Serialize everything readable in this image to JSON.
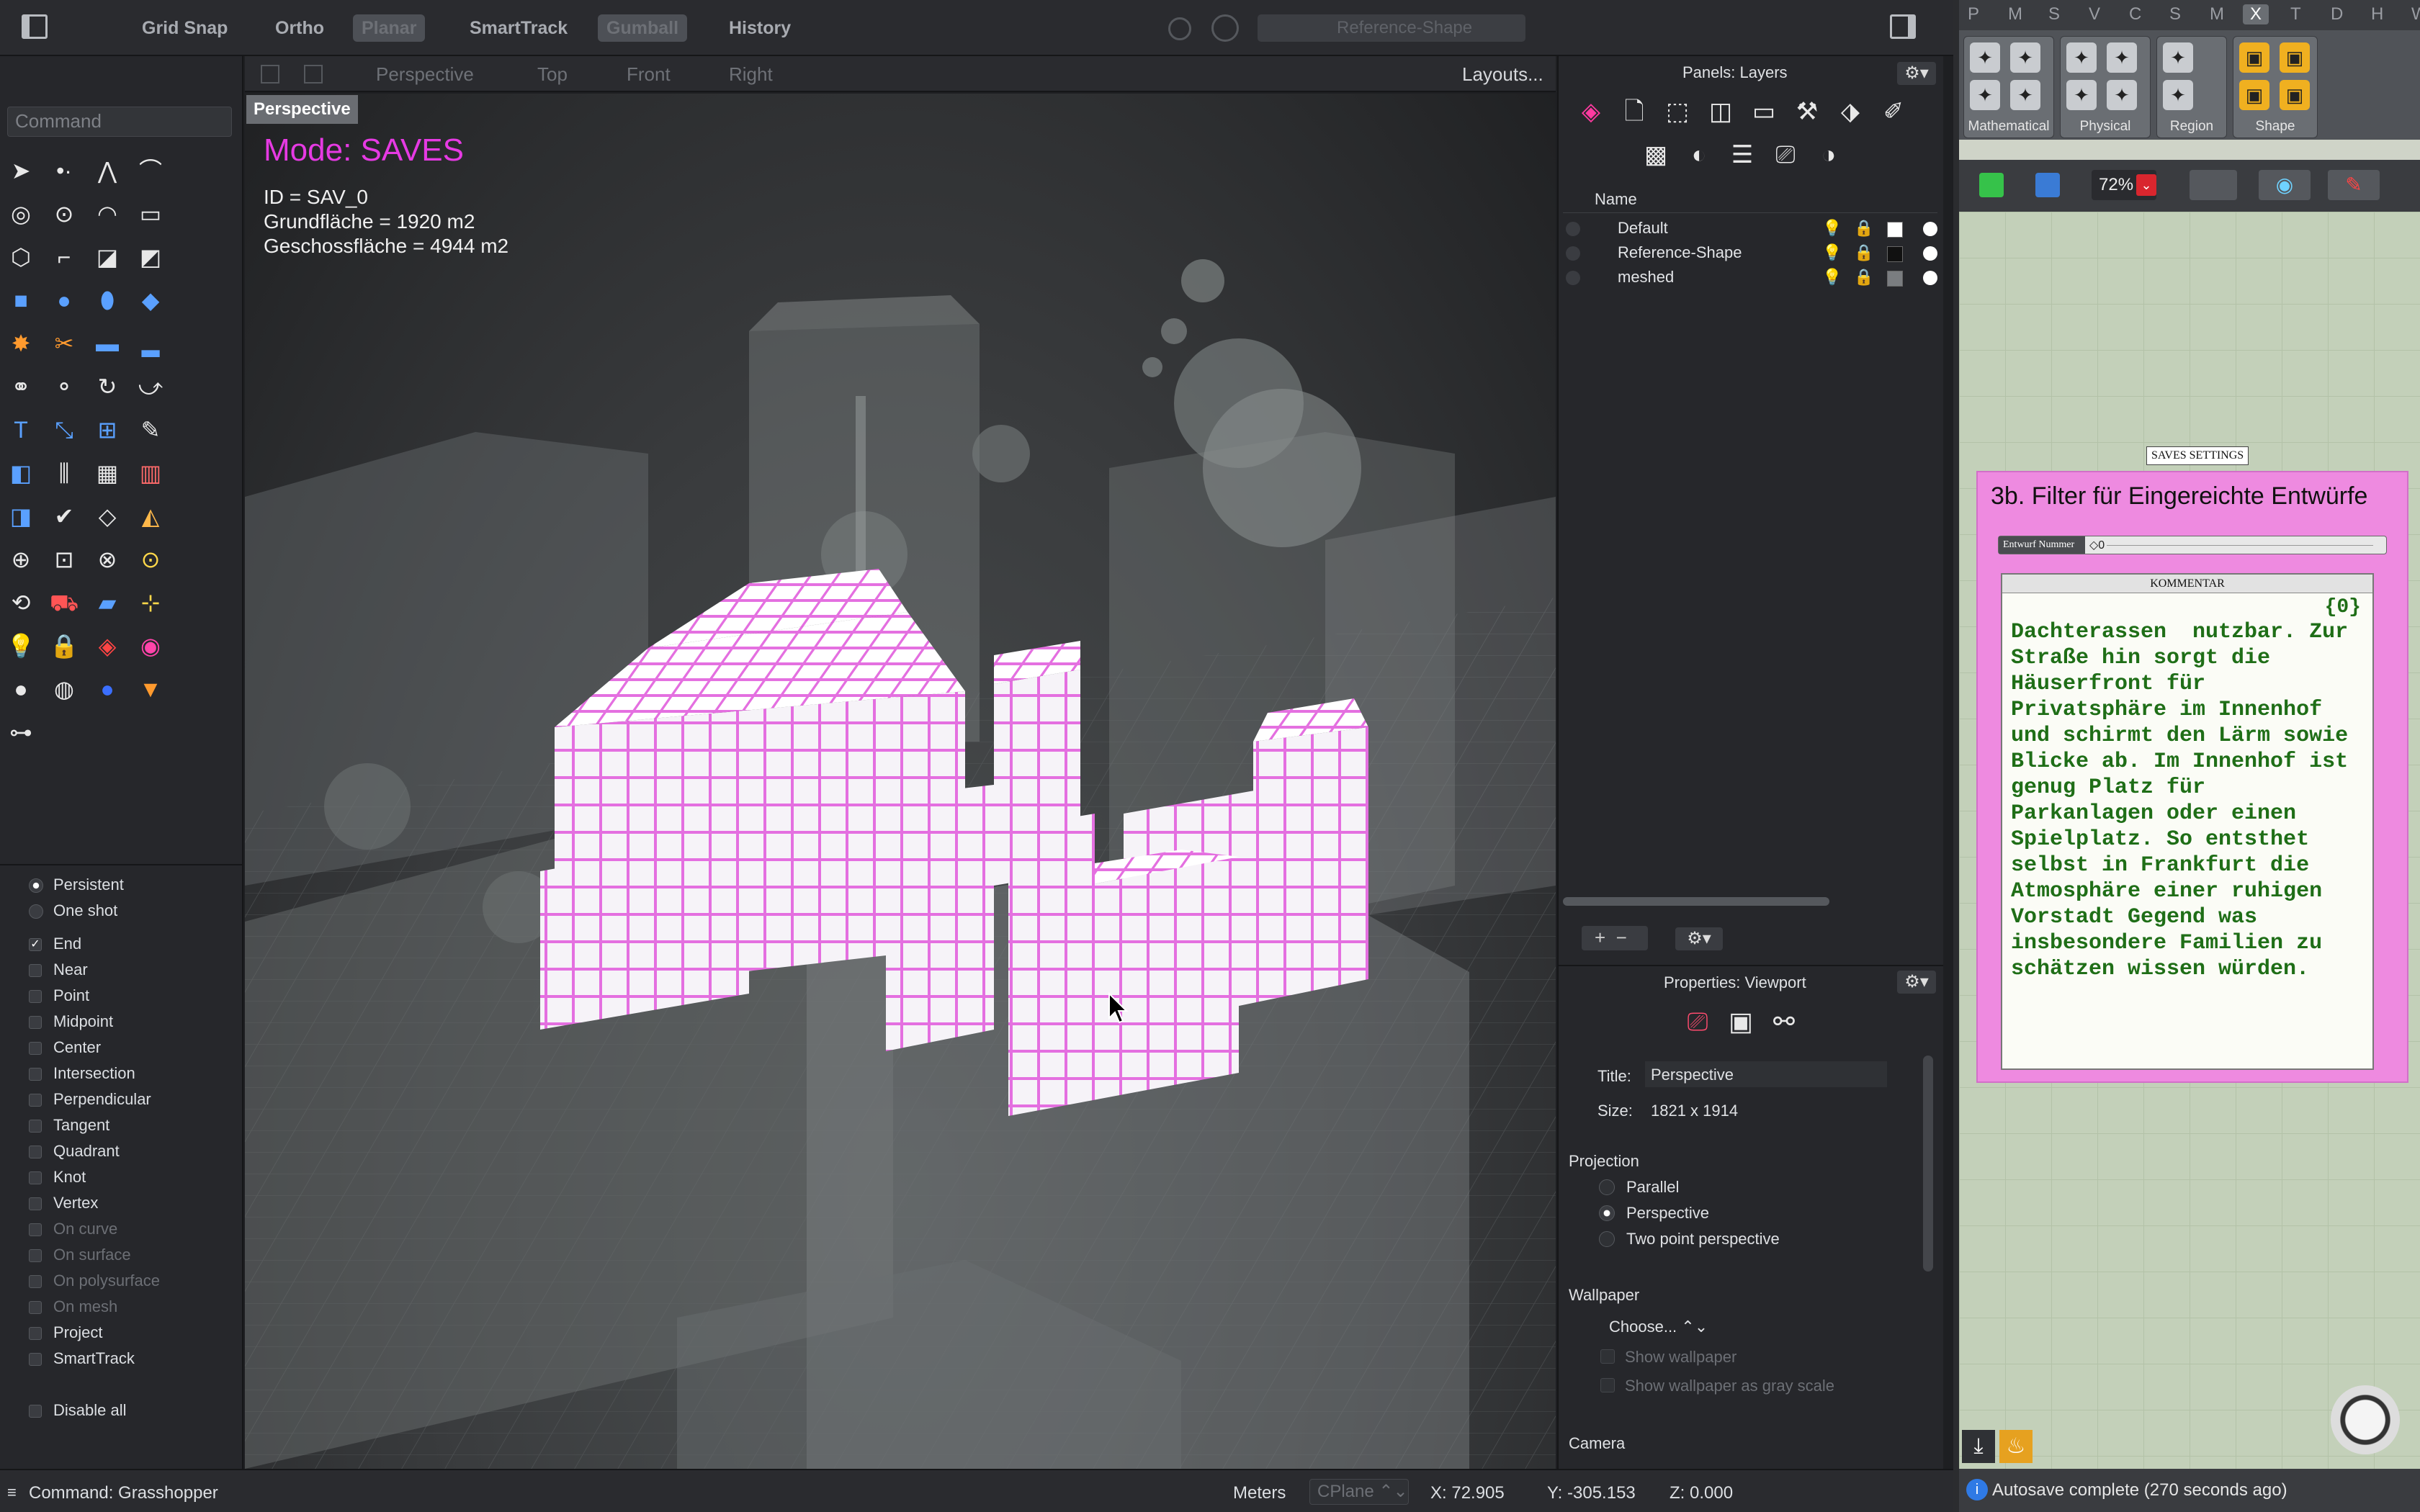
{
  "toolbar": {
    "grid_snap": "Grid Snap",
    "ortho": "Ortho",
    "planar": "Planar",
    "smarttrack": "SmartTrack",
    "gumball": "Gumball",
    "history": "History",
    "layer_field": "Reference-Shape"
  },
  "command": {
    "placeholder": "Command"
  },
  "viewport_tabs": {
    "perspective": "Perspective",
    "top": "Top",
    "front": "Front",
    "right": "Right",
    "layouts": "Layouts..."
  },
  "viewport": {
    "label": "Perspective",
    "mode": "Mode: SAVES",
    "id_line": "ID = SAV_0",
    "grundflaeche": "Grundfläche = 1920 m2",
    "geschossflaeche": "Geschossfläche = 4944 m2"
  },
  "osnaps": [
    {
      "label": "Persistent",
      "type": "radio",
      "on": true,
      "dim": false
    },
    {
      "label": "One shot",
      "type": "radio",
      "on": false,
      "dim": false
    },
    {
      "label": "End",
      "type": "check",
      "on": true,
      "dim": false
    },
    {
      "label": "Near",
      "type": "check",
      "on": false,
      "dim": false
    },
    {
      "label": "Point",
      "type": "check",
      "on": false,
      "dim": false
    },
    {
      "label": "Midpoint",
      "type": "check",
      "on": false,
      "dim": false
    },
    {
      "label": "Center",
      "type": "check",
      "on": false,
      "dim": false
    },
    {
      "label": "Intersection",
      "type": "check",
      "on": false,
      "dim": false
    },
    {
      "label": "Perpendicular",
      "type": "check",
      "on": false,
      "dim": false
    },
    {
      "label": "Tangent",
      "type": "check",
      "on": false,
      "dim": false
    },
    {
      "label": "Quadrant",
      "type": "check",
      "on": false,
      "dim": false
    },
    {
      "label": "Knot",
      "type": "check",
      "on": false,
      "dim": false
    },
    {
      "label": "Vertex",
      "type": "check",
      "on": false,
      "dim": false
    },
    {
      "label": "On curve",
      "type": "check",
      "on": false,
      "dim": true
    },
    {
      "label": "On surface",
      "type": "check",
      "on": false,
      "dim": true
    },
    {
      "label": "On polysurface",
      "type": "check",
      "on": false,
      "dim": true
    },
    {
      "label": "On mesh",
      "type": "check",
      "on": false,
      "dim": true
    },
    {
      "label": "Project",
      "type": "check",
      "on": false,
      "dim": false
    },
    {
      "label": "SmartTrack",
      "type": "check",
      "on": false,
      "dim": false
    },
    {
      "label": "Disable all",
      "type": "check",
      "on": false,
      "dim": false
    }
  ],
  "layers_panel": {
    "title": "Panels: Layers",
    "column_name": "Name",
    "layers": [
      {
        "name": "Default",
        "color": "#ffffff"
      },
      {
        "name": "Reference-Shape",
        "color": "#111111"
      },
      {
        "name": "meshed",
        "color": "#7a7d80"
      }
    ]
  },
  "properties": {
    "title": "Properties: Viewport",
    "title_label": "Title:",
    "title_value": "Perspective",
    "size_label": "Size:",
    "size_value": "1821 x 1914",
    "projection_heading": "Projection",
    "projection_options": [
      "Parallel",
      "Perspective",
      "Two point perspective"
    ],
    "projection_selected": "Perspective",
    "wallpaper_heading": "Wallpaper",
    "choose": "Choose...",
    "show_wallpaper": "Show wallpaper",
    "show_gray": "Show wallpaper as gray scale",
    "camera_heading": "Camera"
  },
  "statusbar": {
    "command": "Command: Grasshopper",
    "units": "Meters",
    "cplane": "CPlane",
    "x": "X: 72.905",
    "y": "Y: -305.153",
    "z": "Z: 0.000"
  },
  "grasshopper": {
    "tabs": [
      "P",
      "M",
      "S",
      "V",
      "C",
      "S",
      "M",
      "X",
      "T",
      "D",
      "H",
      "W"
    ],
    "active_tab": "X",
    "groups": [
      "Mathematical",
      "Physical",
      "Region",
      "Shape"
    ],
    "zoom": "72%",
    "saves_settings": "SAVES SETTINGS",
    "group_title": "3b. Filter für Eingereichte Entwürfe",
    "slider_label": "Entwurf Nummer",
    "slider_value": "◇0",
    "panel_title": "KOMMENTAR",
    "panel_path": "{0}",
    "panel_index": "0",
    "comment": "Dachterassen  nutzbar. Zur\nStraße hin sorgt die\nHäuserfront für\nPrivatsphäre im Innenhof\nund schirmt den Lärm sowie\nBlicke ab. Im Innenhof ist\ngenug Platz für\nParkanlagen oder einen\nSpielplatz. So entsthet\nselbst in Frankfurt die\nAtmosphäre einer ruhigen\nVorstadt Gegend was\ninsbesondere Familien zu\nschätzen wissen würden.",
    "autosave": "Autosave complete (270 seconds ago)"
  },
  "accent": "#e63ae3"
}
